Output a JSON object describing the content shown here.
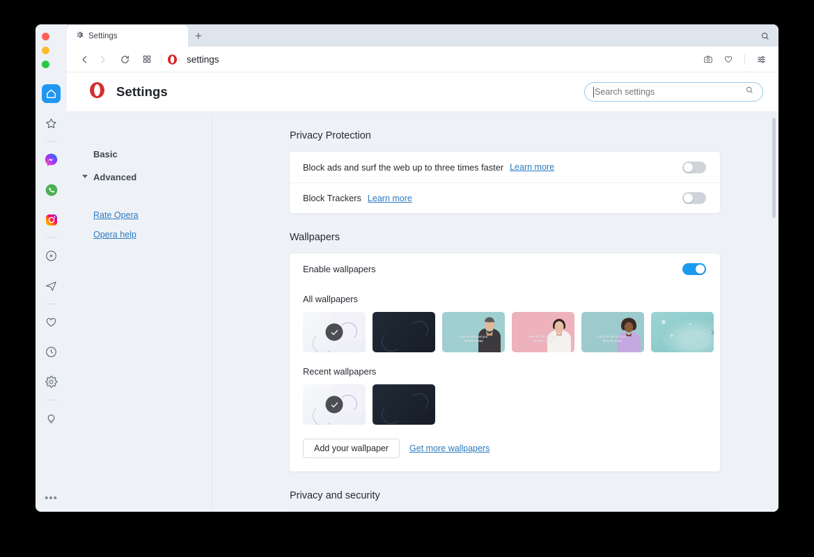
{
  "window": {
    "traffic_lights": [
      "close",
      "minimize",
      "maximize"
    ]
  },
  "appbar": {
    "icons": [
      {
        "name": "home-icon",
        "label": "Home",
        "active": true
      },
      {
        "name": "star-icon",
        "label": "Speed Dial",
        "active": false
      },
      {
        "name": "messenger-icon",
        "label": "Messenger",
        "active": false
      },
      {
        "name": "whatsapp-icon",
        "label": "WhatsApp",
        "active": false
      },
      {
        "name": "instagram-icon",
        "label": "Instagram",
        "active": false
      },
      {
        "name": "player-icon",
        "label": "Player",
        "active": false
      },
      {
        "name": "telegram-icon",
        "label": "Telegram",
        "active": false
      },
      {
        "name": "heart-icon",
        "label": "Favorites",
        "active": false
      },
      {
        "name": "history-icon",
        "label": "History",
        "active": false
      },
      {
        "name": "gear-icon",
        "label": "Settings",
        "active": false
      },
      {
        "name": "bulb-icon",
        "label": "Tips",
        "active": false
      }
    ],
    "more_label": "•••"
  },
  "tabbar": {
    "tab_title": "Settings",
    "new_tab_label": "+",
    "search_icon": "search-icon"
  },
  "addressbar": {
    "url": "settings",
    "back_icon": "chevron-left-icon",
    "forward_icon": "chevron-right-icon",
    "reload_icon": "reload-icon",
    "tiles_icon": "grid-icon",
    "brand_icon": "opera-logo-icon",
    "right_icons": [
      "camera-icon",
      "heart-icon",
      "easy-setup-icon"
    ]
  },
  "header": {
    "title": "Settings",
    "logo": "opera-logo-icon"
  },
  "search": {
    "placeholder": "Search settings",
    "value": "",
    "icon": "search-icon"
  },
  "nav": {
    "items": [
      {
        "label": "Basic",
        "expandable": false,
        "expanded": false
      },
      {
        "label": "Advanced",
        "expandable": true,
        "expanded": true
      }
    ],
    "links": [
      {
        "label": "Rate Opera"
      },
      {
        "label": "Opera help"
      }
    ]
  },
  "sections": {
    "privacy_protection": {
      "title": "Privacy Protection",
      "rows": [
        {
          "label": "Block ads and surf the web up to three times faster",
          "link": "Learn more",
          "toggle_on": false
        },
        {
          "label": "Block Trackers",
          "link": "Learn more",
          "toggle_on": false
        }
      ]
    },
    "wallpapers": {
      "title": "Wallpapers",
      "enable_label": "Enable wallpapers",
      "enable_toggle_on": true,
      "all_label": "All wallpapers",
      "recent_label": "Recent wallpapers",
      "caption_line1": "Time for the real you.",
      "caption_line2": "Browse away",
      "all_items": [
        {
          "name": "wallpaper-light-abstract",
          "style": "wp-light",
          "selected": true,
          "caption": false,
          "person": null
        },
        {
          "name": "wallpaper-dark-abstract",
          "style": "wp-dark",
          "selected": false,
          "caption": false,
          "person": null
        },
        {
          "name": "wallpaper-teal-man",
          "style": "wp-teal",
          "selected": false,
          "caption": true,
          "person": "man"
        },
        {
          "name": "wallpaper-pink-woman",
          "style": "wp-pink",
          "selected": false,
          "caption": true,
          "person": "woman"
        },
        {
          "name": "wallpaper-teal-woman",
          "style": "wp-teal2",
          "selected": false,
          "caption": true,
          "person": "woman2"
        },
        {
          "name": "wallpaper-aqua-bokeh",
          "style": "wp-aqua",
          "selected": false,
          "caption": false,
          "person": null
        }
      ],
      "recent_items": [
        {
          "name": "wallpaper-light-abstract",
          "style": "wp-light",
          "selected": true,
          "caption": false,
          "person": null
        },
        {
          "name": "wallpaper-dark-abstract",
          "style": "wp-dark",
          "selected": false,
          "caption": false,
          "person": null
        }
      ],
      "next_arrow_icon": "chevron-right-icon",
      "add_button": "Add your wallpaper",
      "more_link": "Get more wallpapers"
    },
    "privacy_and_security": {
      "title": "Privacy and security"
    }
  },
  "colors": {
    "accent_blue": "#1a9bf0",
    "link_blue": "#2b7bc0",
    "opera_red": "#d32f2f",
    "page_bg": "#eef2f7",
    "card_bg": "#ffffff",
    "toggle_off": "#cfd4da"
  }
}
